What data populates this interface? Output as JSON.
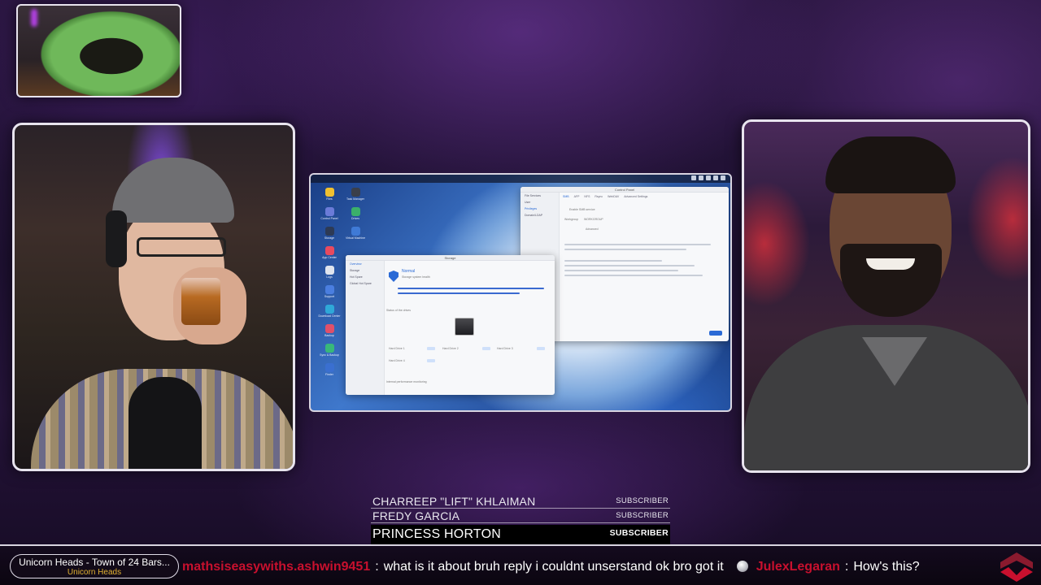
{
  "subscribers": [
    {
      "name": "CHARREEP \"LIFT\" KHLAIMAN",
      "tag": "SUBSCRIBER"
    },
    {
      "name": "FREDY GARCIA",
      "tag": "SUBSCRIBER"
    },
    {
      "name": "PRINCESS HORTON",
      "tag": "SUBSCRIBER"
    }
  ],
  "now_playing": {
    "track": "Unicorn Heads - Town of 24 Bars...",
    "artist": "Unicorn Heads"
  },
  "chat": [
    {
      "user": "mathsiseasywiths.ashwin9451",
      "message": "what is it about  bruh reply i couldnt unserstand  ok bro got it"
    },
    {
      "user": "JulexLegaran",
      "message": "How's this?"
    }
  ],
  "colors": {
    "chat_user": "#c8102e",
    "artist": "#e2b233",
    "accent_blue": "#2a6ad6"
  },
  "icons": {
    "chat_emote": "orb-emote-icon",
    "brand": "chevron-logo-icon",
    "shield": "shield-icon"
  },
  "screen_share": {
    "storage_window": {
      "title": "Storage",
      "sidebar": [
        "Overview",
        "Storage",
        "Hot Spare",
        "Global Hot Spare"
      ],
      "status": "Normal",
      "status_sub": "Storage system health",
      "section_title": "Status of the drives",
      "drives": [
        "Hard Drive 1",
        "Hard Drive 2",
        "Hard Drive 3",
        "Hard Drive 4"
      ],
      "drive_status": "Normal",
      "footer": "Internal performance monitoring"
    },
    "control_window": {
      "title": "Control Panel",
      "tabs": [
        "SMB",
        "AFP",
        "NFS",
        "Rsync",
        "WebDAV",
        "Advanced Settings"
      ],
      "sidebar": [
        "File Services",
        "User",
        "Privileges",
        "Domain/LDAP"
      ],
      "labels": [
        "Enable SMB service",
        "Workgroup",
        "WORKGROUP",
        "Advanced",
        "Apply"
      ]
    },
    "desktop_icons": [
      "Files",
      "Task Manager",
      "Control Panel",
      "Drives",
      "Storage",
      "Virtual Machine",
      "App Center",
      "Logs",
      "Support",
      "Download Center",
      "Backup",
      "Sync & Backup",
      "Finder"
    ]
  }
}
